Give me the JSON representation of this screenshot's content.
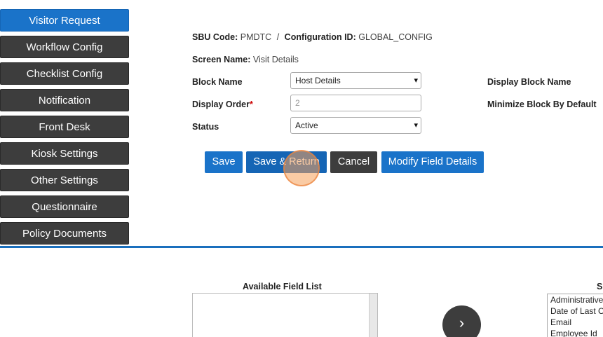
{
  "sidebar": {
    "items": [
      {
        "label": "Visitor Request",
        "active": true
      },
      {
        "label": "Workflow Config"
      },
      {
        "label": "Checklist Config"
      },
      {
        "label": "Notification"
      },
      {
        "label": "Front Desk"
      },
      {
        "label": "Kiosk Settings"
      },
      {
        "label": "Other Settings"
      },
      {
        "label": "Questionnaire"
      },
      {
        "label": "Policy Documents"
      }
    ]
  },
  "header": {
    "sbu_label": "SBU Code:",
    "sbu_value": "PMDTC",
    "separator": "/",
    "config_label": "Configuration ID:",
    "config_value": "GLOBAL_CONFIG",
    "screen_label": "Screen Name:",
    "screen_value": "Visit Details"
  },
  "form": {
    "block_name_label": "Block Name",
    "block_name_value": "Host Details",
    "display_order_label": "Display Order",
    "required_mark": "*",
    "display_order_placeholder": "2",
    "status_label": "Status",
    "status_value": "Active",
    "display_block_name_label": "Display Block Name",
    "minimize_label": "Minimize Block By Default"
  },
  "actions": {
    "save": "Save",
    "save_return": "Save & Return",
    "cancel": "Cancel",
    "modify": "Modify Field Details"
  },
  "fields": {
    "available_title": "Available Field List",
    "selected_title": "S",
    "move_icon": "chevron-right-icon",
    "selected_items": [
      "Administrative",
      "Date of Last C",
      "Email",
      "Employee Id"
    ]
  },
  "colors": {
    "primary": "#1a73c9",
    "dark": "#3d3d3d",
    "divider": "#1a6fbd"
  }
}
